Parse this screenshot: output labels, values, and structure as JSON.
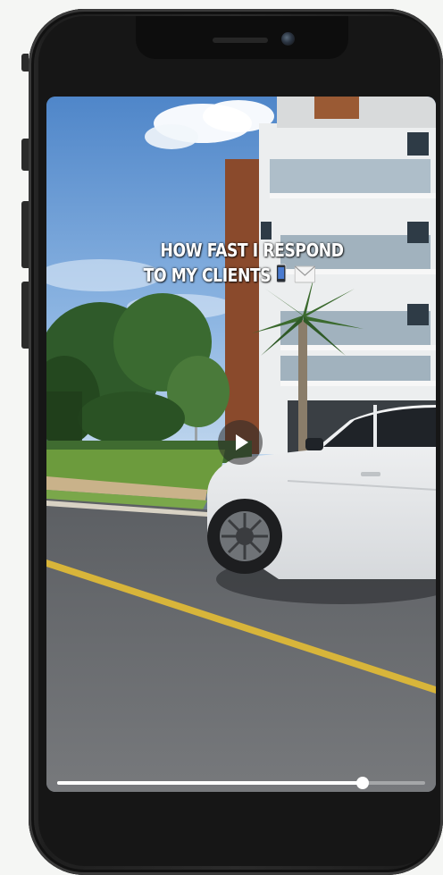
{
  "video": {
    "caption_line1": "HOW FAST I RESPOND",
    "caption_line2": "TO MY CLIENTS",
    "emojis": [
      "mobile-phone-icon",
      "envelope-icon"
    ],
    "progress_fraction": 0.83
  }
}
